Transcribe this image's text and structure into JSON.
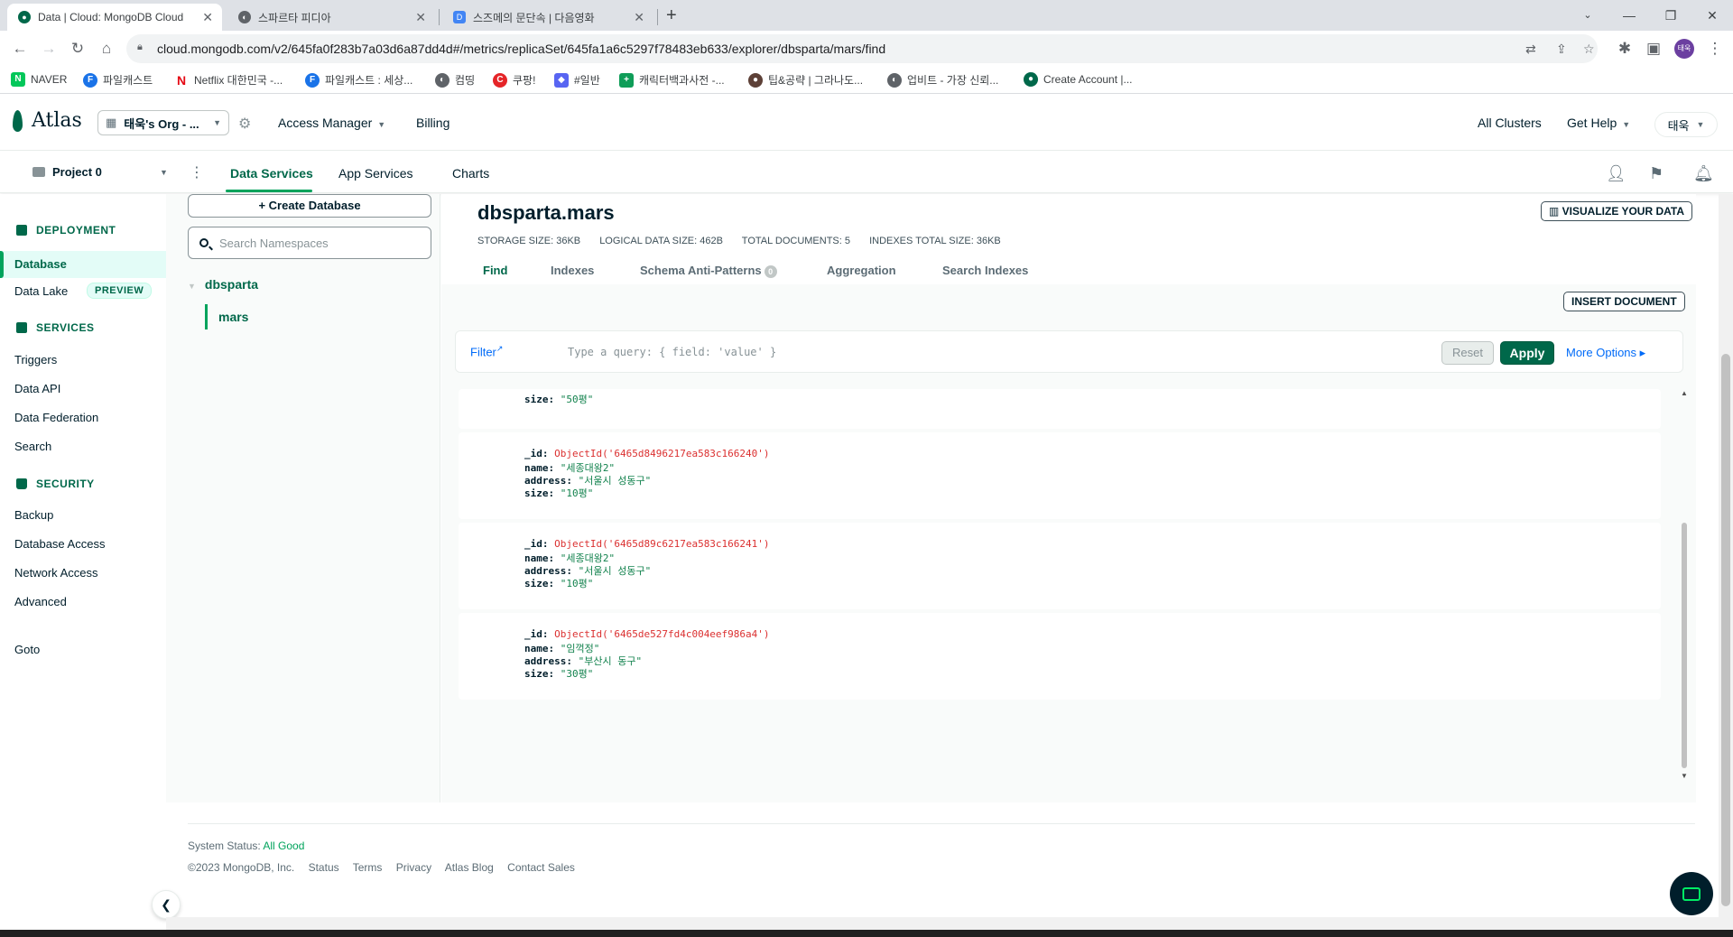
{
  "browser": {
    "tabs": [
      {
        "title": "Data | Cloud: MongoDB Cloud",
        "favicon_color": "#00684a"
      },
      {
        "title": "스파르타 피디아",
        "favicon_color": "#5f6368"
      },
      {
        "title": "스즈메의 문단속 | 다음영화",
        "favicon_color": "#4285f4"
      }
    ],
    "url": "cloud.mongodb.com/v2/645fa0f283b7a03d6a87dd4d#/metrics/replicaSet/645fa1a6c5297f78483eb633/explorer/dbsparta/mars/find",
    "profile_initials": "태욱",
    "bookmarks": [
      {
        "label": "NAVER",
        "icon": "N",
        "color": "#03c75a"
      },
      {
        "label": "파일캐스트",
        "icon": "F",
        "color": "#1a73e8"
      },
      {
        "label": "Netflix 대한민국 -...",
        "icon": "N",
        "color": "#e50914"
      },
      {
        "label": "파일캐스트 : 세상...",
        "icon": "F",
        "color": "#1a73e8"
      },
      {
        "label": "컴띵",
        "icon": "◐",
        "color": "#5f6368"
      },
      {
        "label": "쿠팡!",
        "icon": "C",
        "color": "#e52528"
      },
      {
        "label": "#일반",
        "icon": "◆",
        "color": "#5865f2"
      },
      {
        "label": "캐릭터백과사전 -...",
        "icon": "+",
        "color": "#0f9d58"
      },
      {
        "label": "팁&공략 | 그라나도...",
        "icon": "●",
        "color": "#5d4037"
      },
      {
        "label": "업비트 - 가장 신뢰...",
        "icon": "◐",
        "color": "#5f6368"
      },
      {
        "label": "Create Account |...",
        "icon": "●",
        "color": "#00684a"
      }
    ]
  },
  "atlas": {
    "logo_text": "Atlas",
    "org_name": "태욱's Org - ...",
    "access_manager": "Access Manager",
    "billing": "Billing",
    "all_clusters": "All Clusters",
    "get_help": "Get Help",
    "user": "태욱",
    "project": "Project 0",
    "project_tabs": [
      "Data Services",
      "App Services",
      "Charts"
    ]
  },
  "sidebar": {
    "deployment_header": "DEPLOYMENT",
    "database": "Database",
    "data_lake": "Data Lake",
    "preview_badge": "PREVIEW",
    "services_header": "SERVICES",
    "services": [
      "Triggers",
      "Data API",
      "Data Federation",
      "Search"
    ],
    "security_header": "SECURITY",
    "security": [
      "Backup",
      "Database Access",
      "Network Access",
      "Advanced"
    ],
    "goto": "Goto"
  },
  "namespaces": {
    "create_db": "+ Create Database",
    "search_placeholder": "Search Namespaces",
    "database": "dbsparta",
    "collection": "mars"
  },
  "collection": {
    "title": "dbsparta.mars",
    "stats": [
      "STORAGE SIZE: 36KB",
      "LOGICAL DATA SIZE: 462B",
      "TOTAL DOCUMENTS: 5",
      "INDEXES TOTAL SIZE: 36KB"
    ],
    "visualize": "VISUALIZE YOUR DATA",
    "tabs": [
      "Find",
      "Indexes",
      "Schema Anti-Patterns",
      "Aggregation",
      "Search Indexes"
    ],
    "anti_pattern_count": "0",
    "insert_document": "INSERT DOCUMENT",
    "filter_label": "Filter",
    "query_placeholder": "Type a query: { field: 'value' }",
    "reset": "Reset",
    "apply": "Apply",
    "more_options": "More Options ▸",
    "partial_doc_size": "\"50평\"",
    "documents": [
      {
        "id": "ObjectId('6465d8496217ea583c166240')",
        "name": "\"세종대왕2\"",
        "address": "\"서울시 성동구\"",
        "size": "\"10평\""
      },
      {
        "id": "ObjectId('6465d89c6217ea583c166241')",
        "name": "\"세종대왕2\"",
        "address": "\"서울시 성동구\"",
        "size": "\"10평\""
      },
      {
        "id": "ObjectId('6465de527fd4c004eef986a4')",
        "name": "\"임꺽정\"",
        "address": "\"부산시 동구\"",
        "size": "\"30평\""
      }
    ]
  },
  "footer": {
    "status_label": "System Status: ",
    "status_value": "All Good",
    "links": [
      "©2023 MongoDB, Inc.",
      "Status",
      "Terms",
      "Privacy",
      "Atlas Blog",
      "Contact Sales"
    ]
  }
}
